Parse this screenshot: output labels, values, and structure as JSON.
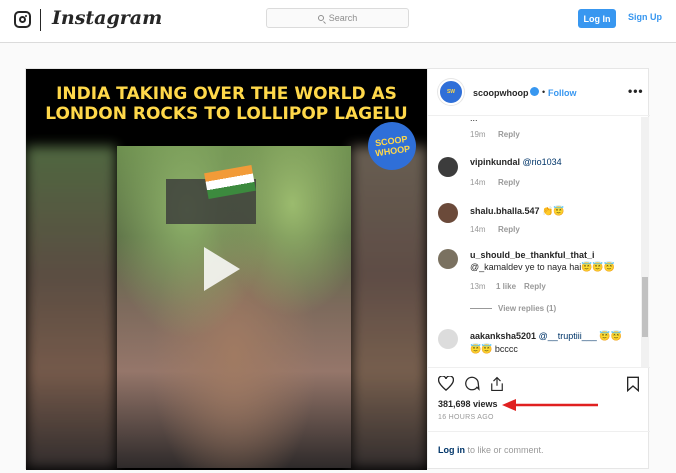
{
  "nav": {
    "brand": "Instagram",
    "search_placeholder": "Search",
    "login_label": "Log In",
    "signup_label": "Sign Up"
  },
  "media": {
    "headline": "INDIA TAKING OVER THE WORLD AS LONDON ROCKS TO LOLLIPOP LAGELU",
    "logo_text": "SCOOP WHOOP"
  },
  "post": {
    "username": "scoopwhoop",
    "separator": "•",
    "follow_label": "Follow",
    "more_label": "•••",
    "views": "381,698 views",
    "time_ago": "16 HOURS AGO",
    "login_link": "Log in",
    "login_suffix": " to like or comment."
  },
  "comments": [
    {
      "time": "19m",
      "reply": "Reply",
      "partial_text": "..."
    },
    {
      "user": "vipinkundal",
      "text": "@rio1034",
      "time": "14m",
      "reply": "Reply"
    },
    {
      "user": "shalu.bhalla.547",
      "text": "👏😇",
      "time": "14m",
      "reply": "Reply"
    },
    {
      "user": "u_should_be_thankful_that_i",
      "text": "@_kamaldev ye to naya hai😇😇😇",
      "time": "13m",
      "likes": "1 like",
      "reply": "Reply",
      "view_replies": "View replies (1)"
    },
    {
      "user": "aakanksha5201",
      "text": "@__truptiii___ 😇😇",
      "text2": "😇😇 bcccc",
      "time": "",
      "reply": ""
    }
  ],
  "colors": {
    "accent": "#3897f0",
    "headline_yellow": "#ffd84a",
    "arrow_red": "#e02020"
  }
}
